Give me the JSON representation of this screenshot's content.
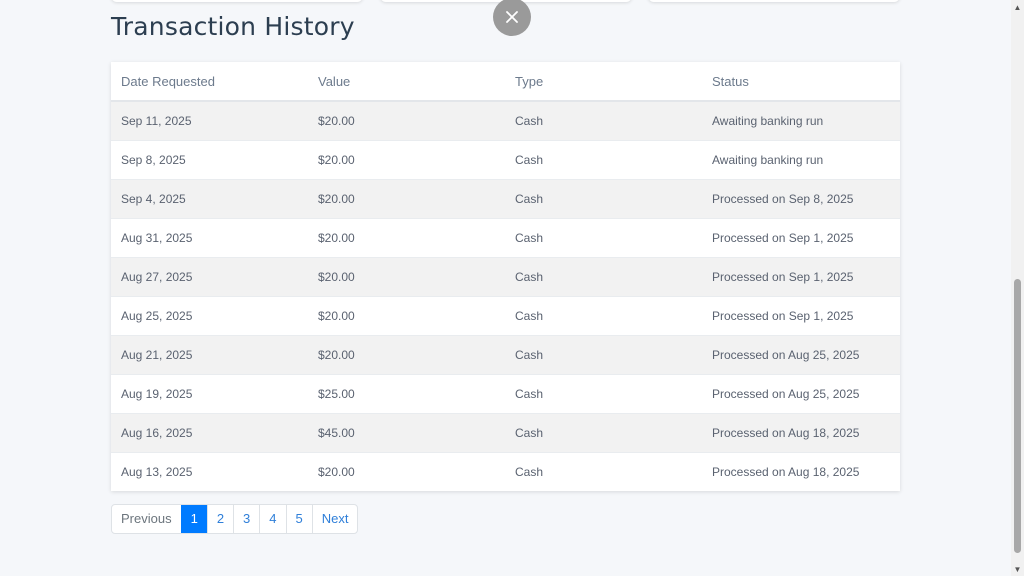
{
  "page": {
    "title": "Transaction History"
  },
  "table": {
    "headers": [
      "Date Requested",
      "Value",
      "Type",
      "Status"
    ],
    "rows": [
      [
        "Sep 11, 2025",
        "$20.00",
        "Cash",
        "Awaiting banking run"
      ],
      [
        "Sep 8, 2025",
        "$20.00",
        "Cash",
        "Awaiting banking run"
      ],
      [
        "Sep 4, 2025",
        "$20.00",
        "Cash",
        "Processed on Sep 8, 2025"
      ],
      [
        "Aug 31, 2025",
        "$20.00",
        "Cash",
        "Processed on Sep 1, 2025"
      ],
      [
        "Aug 27, 2025",
        "$20.00",
        "Cash",
        "Processed on Sep 1, 2025"
      ],
      [
        "Aug 25, 2025",
        "$20.00",
        "Cash",
        "Processed on Sep 1, 2025"
      ],
      [
        "Aug 21, 2025",
        "$20.00",
        "Cash",
        "Processed on Aug 25, 2025"
      ],
      [
        "Aug 19, 2025",
        "$25.00",
        "Cash",
        "Processed on Aug 25, 2025"
      ],
      [
        "Aug 16, 2025",
        "$45.00",
        "Cash",
        "Processed on Aug 18, 2025"
      ],
      [
        "Aug 13, 2025",
        "$20.00",
        "Cash",
        "Processed on Aug 18, 2025"
      ]
    ]
  },
  "pagination": {
    "previous": "Previous",
    "pages": [
      "1",
      "2",
      "3",
      "4",
      "5"
    ],
    "current": "1",
    "next": "Next"
  },
  "colors": {
    "accent": "#007bff",
    "title": "#2c3e50",
    "row_alt": "#f2f2f2"
  },
  "icons": {
    "close": "close-icon",
    "scroll_up": "scroll-up-arrow-icon",
    "scroll_down": "scroll-down-arrow-icon"
  }
}
